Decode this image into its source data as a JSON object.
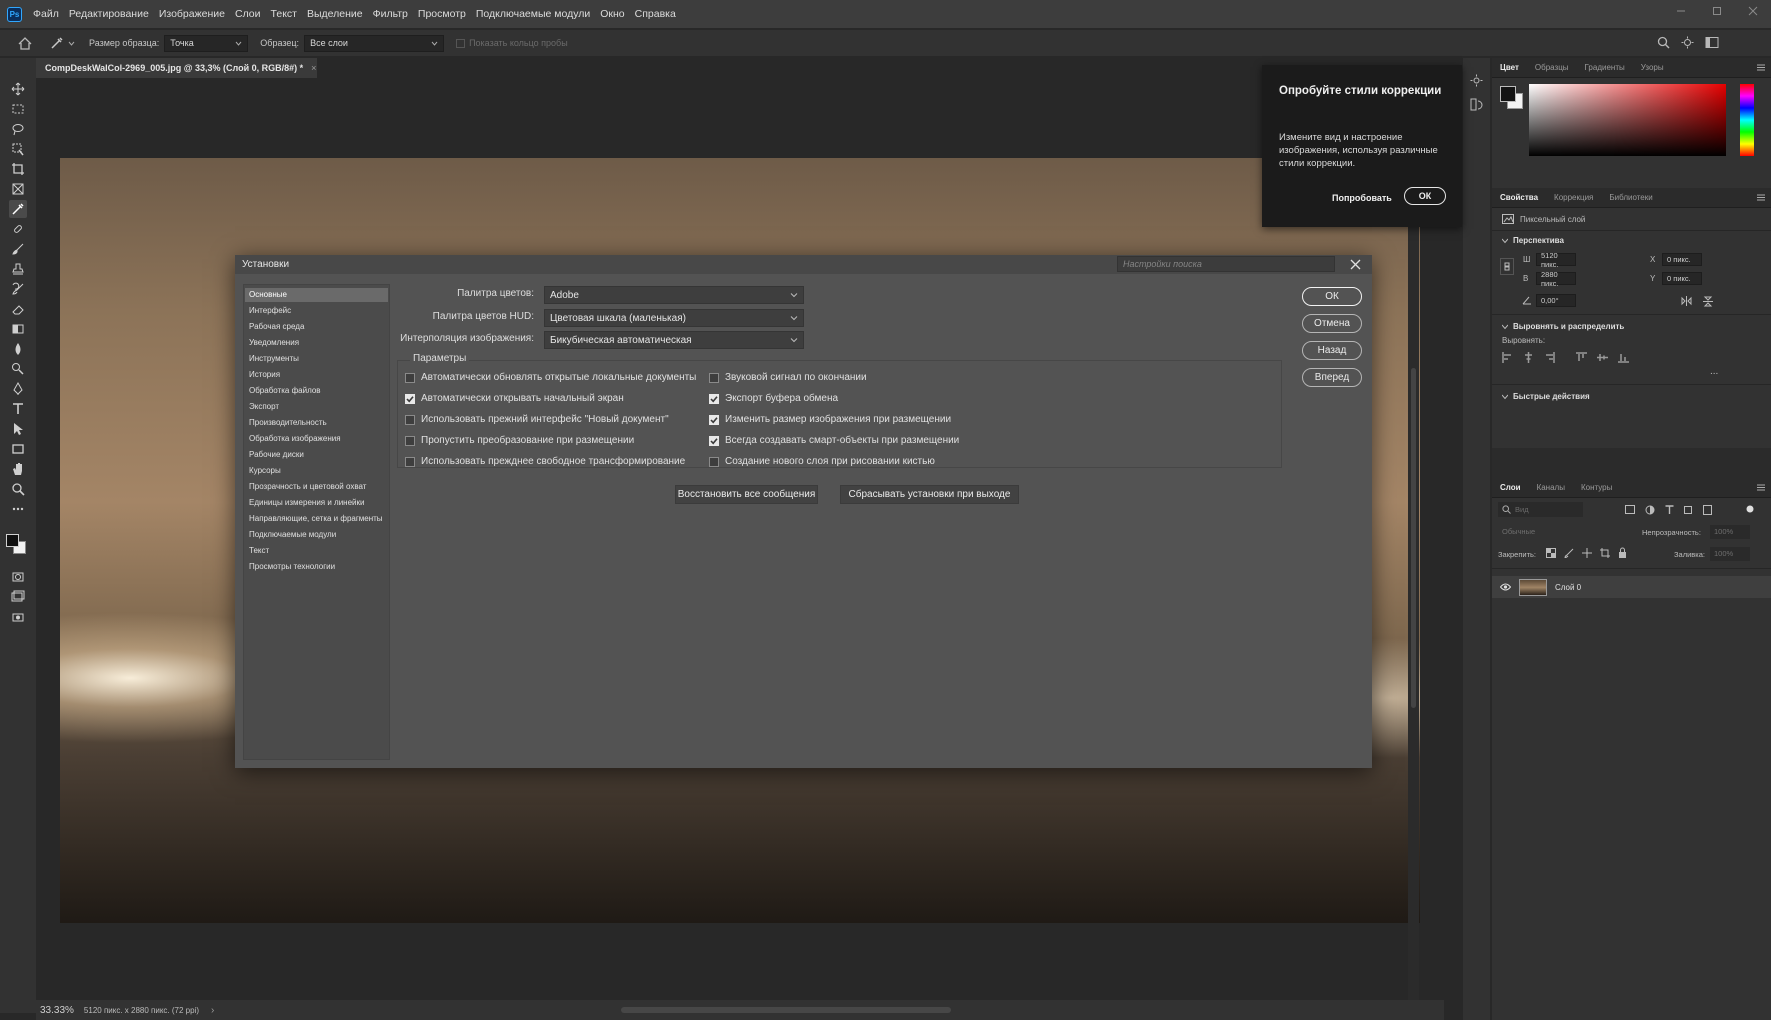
{
  "app": {
    "logo": "Ps"
  },
  "menu": [
    "Файл",
    "Редактирование",
    "Изображение",
    "Слои",
    "Текст",
    "Выделение",
    "Фильтр",
    "Просмотр",
    "Подключаемые модули",
    "Окно",
    "Справка"
  ],
  "options_bar": {
    "sample_size_label": "Размер образца:",
    "sample_size_value": "Точка",
    "sample_label": "Образец:",
    "sample_value": "Все слои",
    "show_ring": "Показать кольцо пробы"
  },
  "document": {
    "tab_title": "CompDeskWalCol-2969_005.jpg @ 33,3% (Слой 0, RGB/8#) *",
    "close_glyph": "×"
  },
  "status_bar": {
    "zoom": "33.33%",
    "doc_info": "5120 пикс. x 2880 пикс. (72 ppi)",
    "arrow": "›"
  },
  "tooltip": {
    "title": "Опробуйте стили коррекции",
    "body": "Измените вид и настроение изображения, используя различные стили коррекции.",
    "try_label": "Попробовать",
    "ok_label": "ОК"
  },
  "color_panel": {
    "tabs": [
      "Цвет",
      "Образцы",
      "Градиенты",
      "Узоры"
    ],
    "fg_color": "#141414",
    "bg_color": "#f4f4f4"
  },
  "properties_panel": {
    "tabs": [
      "Свойства",
      "Коррекция",
      "Библиотеки"
    ],
    "layer_type": "Пиксельный слой",
    "transform_title": "Перспектива",
    "w_label": "Ш",
    "w_value": "5120 пикс.",
    "h_label": "В",
    "h_value": "2880 пикс.",
    "x_label": "X",
    "x_value": "0 пикс.",
    "y_label": "Y",
    "y_value": "0 пикс.",
    "angle_value": "0,00°",
    "align_title": "Выровнять и распределить",
    "align_label": "Выровнять:",
    "more": "...",
    "quick_actions_title": "Быстрые действия"
  },
  "layers_panel": {
    "tabs": [
      "Слои",
      "Каналы",
      "Контуры"
    ],
    "search_placeholder": "Вид",
    "blend_mode": "Обычные",
    "opacity_label": "Непрозрачность:",
    "opacity_value": "100%",
    "lock_label": "Закрепить:",
    "fill_label": "Заливка:",
    "fill_value": "100%",
    "layer_name": "Слой 0"
  },
  "preferences": {
    "title": "Установки",
    "search_placeholder": "Настройки поиска",
    "nav": [
      "Основные",
      "Интерфейс",
      "Рабочая среда",
      "Уведомления",
      "Инструменты",
      "История",
      "Обработка файлов",
      "Экспорт",
      "Производительность",
      "Обработка изображения",
      "Рабочие диски",
      "Курсоры",
      "Прозрачность и цветовой охват",
      "Единицы измерения и линейки",
      "Направляющие, сетка и фрагменты",
      "Подключаемые модули",
      "Текст",
      "Просмотры технологии"
    ],
    "active_nav": "Основные",
    "color_picker_label": "Палитра цветов:",
    "color_picker_value": "Adobe",
    "hud_picker_label": "Палитра цветов HUD:",
    "hud_picker_value": "Цветовая шкала (маленькая)",
    "interpolation_label": "Интерполяция изображения:",
    "interpolation_value": "Бикубическая автоматическая",
    "params_label": "Параметры",
    "options_left": [
      {
        "label": "Автоматически обновлять открытые локальные документы",
        "checked": false
      },
      {
        "label": "Автоматически открывать начальный экран",
        "checked": true
      },
      {
        "label": "Использовать прежний интерфейс \"Новый документ\"",
        "checked": false
      },
      {
        "label": "Пропустить преобразование при размещении",
        "checked": false
      },
      {
        "label": "Использовать прежднее свободное трансформирование",
        "checked": false
      }
    ],
    "options_right": [
      {
        "label": "Звуковой сигнал по окончании",
        "checked": false
      },
      {
        "label": "Экспорт буфера обмена",
        "checked": true
      },
      {
        "label": "Изменить размер изображения при размещении",
        "checked": true
      },
      {
        "label": "Всегда создавать смарт-объекты при размещении",
        "checked": true
      },
      {
        "label": "Создание нового слоя при рисовании кистью",
        "checked": false
      }
    ],
    "reset_messages": "Восстановить все сообщения",
    "reset_on_quit": "Сбрасывать установки при выходе",
    "buttons": {
      "ok": "ОК",
      "cancel": "Отмена",
      "prev": "Назад",
      "next": "Вперед"
    }
  }
}
